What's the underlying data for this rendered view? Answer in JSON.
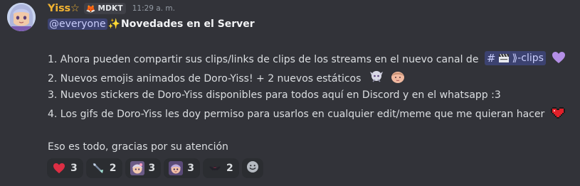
{
  "message": {
    "author": "Yiss☆",
    "tag": {
      "icon": "fox-icon",
      "text": "MDKT"
    },
    "timestamp": "11:29 a. m.",
    "mention": "@everyone",
    "title_emoji": "✨",
    "title": "Novedades en el Server",
    "lines": [
      "1. Ahora pueden compartir sus clips/links de clips de los streams en el nuevo canal de",
      "2. Nuevos emojis animados de Doro-Yiss! + 2 nuevos estáticos",
      "3. Nuevos stickers de Doro-Yiss disponibles para todos aquí en Discord y en el whatsapp :3",
      "4. Los gifs de Doro-Yiss les doy permiso para usarlos en cualquier edit/meme que me quieran hacer"
    ],
    "channel_hash": "#",
    "channel_name": "⟫-clips",
    "closing": "Eso es todo, gracias por su atención"
  },
  "reactions": [
    {
      "emoji": "red-heart-icon",
      "count": "3"
    },
    {
      "emoji": "fairy-wand-icon",
      "count": "2"
    },
    {
      "emoji": "doro-face-icon",
      "count": "3"
    },
    {
      "emoji": "doro-sticker-icon",
      "count": "3"
    },
    {
      "emoji": "bat-icon",
      "count": "2"
    }
  ],
  "colors": {
    "background": "#323339",
    "username": "#f0b232",
    "mention_bg": "#3c4270",
    "mention_text": "#c9cdfb",
    "reaction_bg": "#2b2d31"
  }
}
